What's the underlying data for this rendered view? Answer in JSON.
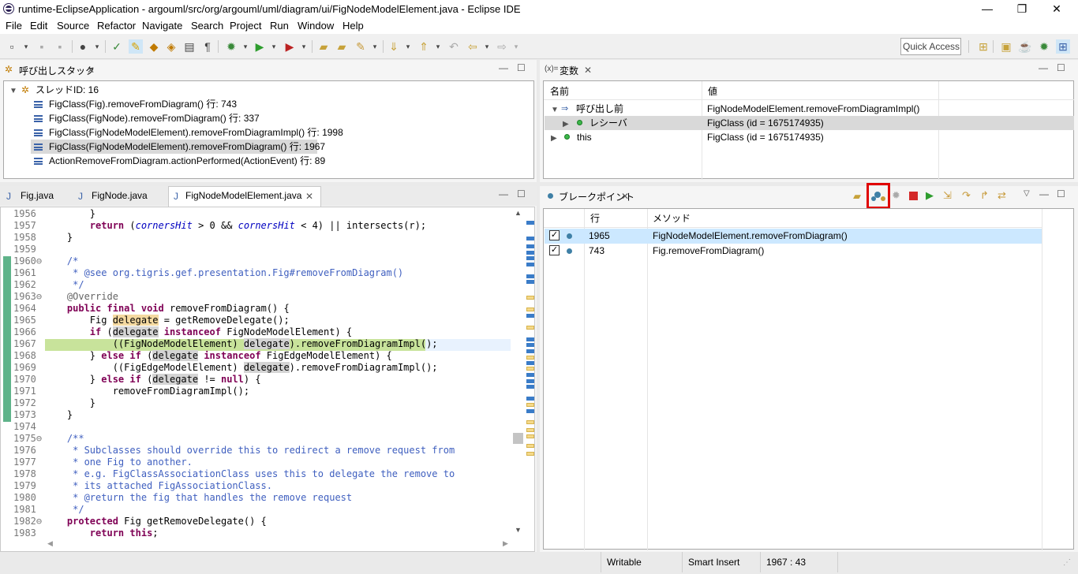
{
  "window": {
    "title": "runtime-EclipseApplication - argouml/src/org/argouml/uml/diagram/ui/FigNodeModelElement.java - Eclipse IDE",
    "minimize": "—",
    "maximize": "❐",
    "close": "✕"
  },
  "menu": [
    "File",
    "Edit",
    "Source",
    "Refactor",
    "Navigate",
    "Search",
    "Project",
    "Run",
    "Window",
    "Help"
  ],
  "quick_access": "Quick Access",
  "callstack": {
    "title": "呼び出しスタック",
    "thread": "スレッドID: 16",
    "frames": [
      "FigClass(Fig).removeFromDiagram() 行: 743",
      "FigClass(FigNode).removeFromDiagram() 行: 337",
      "FigClass(FigNodeModelElement).removeFromDiagramImpl() 行: 1998",
      "FigClass(FigNodeModelElement).removeFromDiagram() 行: 1967",
      "ActionRemoveFromDiagram.actionPerformed(ActionEvent) 行: 89"
    ],
    "selected_index": 3
  },
  "variables": {
    "title": "変数",
    "title_prefix": "(x)=",
    "col_name": "名前",
    "col_value": "値",
    "rows": [
      {
        "name": "呼び出し前",
        "value": "FigNodeModelElement.removeFromDiagramImpl()"
      },
      {
        "name": "レシーバ",
        "value": "FigClass (id = 1675174935)"
      },
      {
        "name": "this",
        "value": "FigClass (id = 1675174935)"
      }
    ]
  },
  "editor": {
    "tabs": [
      "Fig.java",
      "FigNode.java",
      "FigNodeModelElement.java"
    ],
    "active_tab": 2,
    "first_line": 1956,
    "current_line": 1967
  },
  "breakpoints": {
    "title": "ブレークポイント",
    "col_line": "行",
    "col_method": "メソッド",
    "rows": [
      {
        "line": "1965",
        "method": "FigNodeModelElement.removeFromDiagram()",
        "checked": true
      },
      {
        "line": "743",
        "method": "Fig.removeFromDiagram()",
        "checked": true
      }
    ],
    "highlight_color": "#e00000"
  },
  "status": {
    "writable": "Writable",
    "insert": "Smart Insert",
    "position": "1967 : 43"
  },
  "colors": {
    "selection": "#cce8ff",
    "current_line": "#c8e39b",
    "gutter": "#5fb38a"
  }
}
